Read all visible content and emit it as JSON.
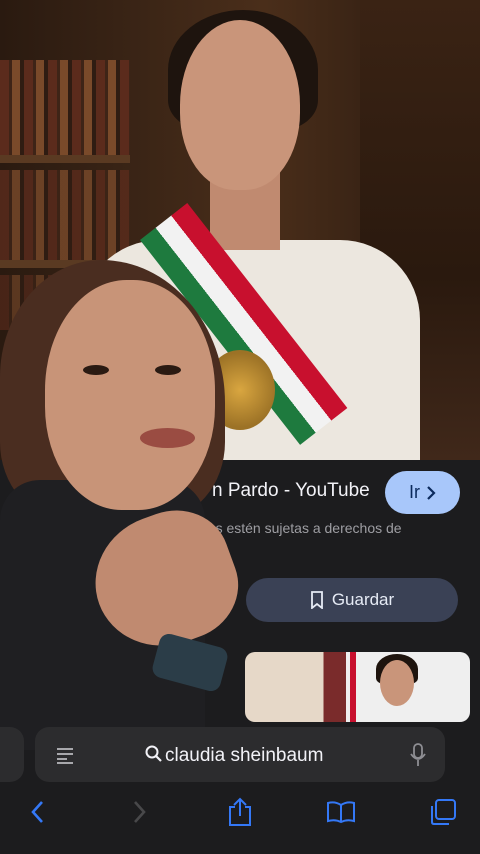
{
  "result": {
    "title": "n Pardo - YouTube",
    "go_label": "Ir",
    "disclaimer": "nes estén sujetas a derechos de",
    "save_label": "Guardar"
  },
  "address_bar": {
    "query": "claudia sheinbaum"
  },
  "colors": {
    "go_button_bg": "#a8c7fa",
    "save_button_bg": "#3a4155",
    "toolbar_accent": "#3478f6"
  },
  "icons": {
    "back": "chevron-left-icon",
    "forward": "chevron-right-icon",
    "share": "share-icon",
    "bookmarks": "book-icon",
    "tabs": "tabs-icon",
    "search": "search-icon",
    "mic": "mic-icon",
    "reader": "reader-icon",
    "bookmark_save": "bookmark-icon"
  }
}
